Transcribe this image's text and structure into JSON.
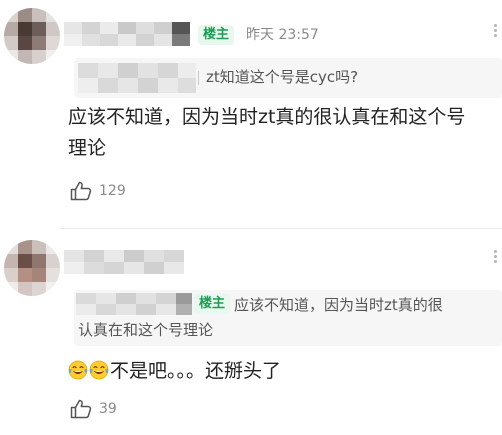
{
  "comments": [
    {
      "badge": "楼主",
      "time": "昨天 23:57",
      "quote_text": "zt知道这个号是cyc吗?",
      "body_line1": "应该不知道，因为当时zt真的很认真在和这个号",
      "body_line2": "理论",
      "likes": "129"
    },
    {
      "quote_badge": "楼主",
      "quote_line1": "应该不知道，因为当时zt真的很",
      "quote_line2": "认真在和这个号理论",
      "emoji": [
        "laughing-crying-emoji",
        "laughing-crying-emoji"
      ],
      "body_text": "不是吧。。。还掰头了",
      "likes": "39"
    }
  ],
  "colors": {
    "badge_bg": "#e8f8ee",
    "badge_text": "#1f9d55",
    "secondary_text": "#8a8a8a",
    "body_text": "#222222"
  }
}
